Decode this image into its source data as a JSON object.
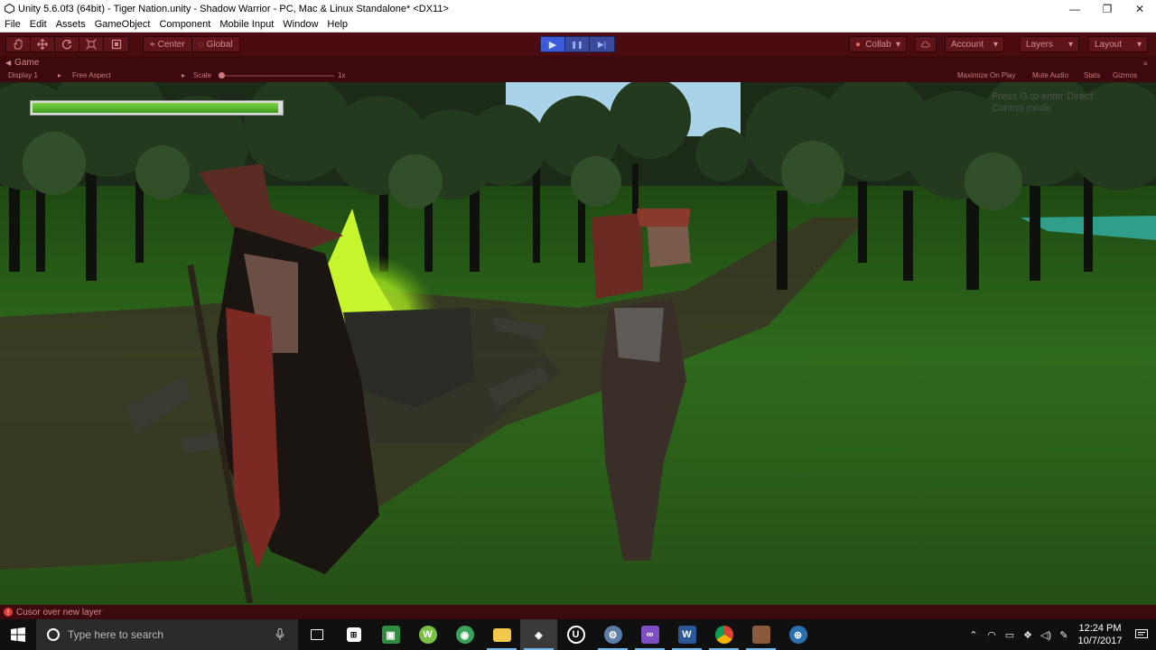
{
  "window": {
    "title": "Unity 5.6.0f3 (64bit) - Tiger Nation.unity - Shadow Warrior - PC, Mac & Linux Standalone* <DX11>",
    "minimize": "—",
    "maximize": "❐",
    "close": "✕"
  },
  "menu": {
    "items": [
      "File",
      "Edit",
      "Assets",
      "GameObject",
      "Component",
      "Mobile Input",
      "Window",
      "Help"
    ]
  },
  "toolbar": {
    "tools": [
      "hand-tool-icon",
      "move-tool-icon",
      "rotate-tool-icon",
      "scale-tool-icon",
      "rect-tool-icon"
    ],
    "pivot_label": "Center",
    "space_label": "Global",
    "play_icon": "▶",
    "pause_icon": "❚❚",
    "step_icon": "▶|",
    "collab_label": "Collab",
    "account_label": "Account",
    "layers_label": "Layers",
    "layout_label": "Layout",
    "caret": "▾"
  },
  "game_view": {
    "tab_label": "Game",
    "display": "Display 1",
    "aspect": "Free Aspect",
    "scale_label": "Scale",
    "scale_value": "1x",
    "maximize_on_play": "Maximize On Play",
    "mute_audio": "Mute Audio",
    "stats": "Stats",
    "gizmos": "Gizmos",
    "health_fraction": 0.99,
    "hint_text": "Press G to enter Direct Control mode",
    "colors": {
      "health": "#5fb82f",
      "grass": "#2a5a1a",
      "sky": "#a9d3e8"
    }
  },
  "status": {
    "message": "Cusor over new layer"
  },
  "taskbar": {
    "search_placeholder": "Type here to search",
    "apps": [
      "task-view-icon",
      "store-icon",
      "app-green-icon",
      "whatsapp-icon",
      "app-green2-icon",
      "file-explorer-icon",
      "unity-icon",
      "unreal-icon",
      "steam-icon",
      "visual-studio-icon",
      "word-icon",
      "chrome-icon",
      "app-photo-icon",
      "app-globe-icon"
    ],
    "time": "12:24 PM",
    "date": "10/7/2017"
  }
}
